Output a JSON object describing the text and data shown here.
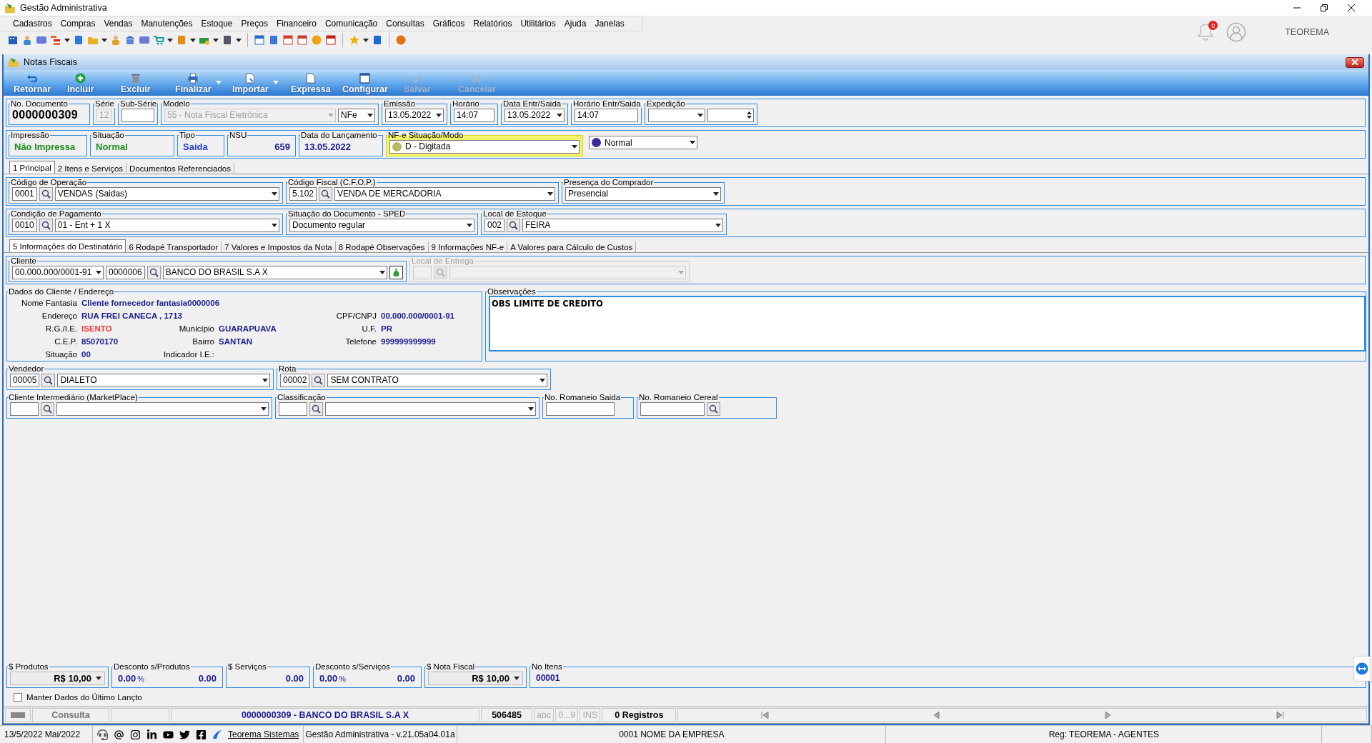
{
  "window": {
    "title": "Gestão Administrativa"
  },
  "menu": [
    "Cadastros",
    "Compras",
    "Vendas",
    "Manutenções",
    "Estoque",
    "Preços",
    "Financeiro",
    "Comunicação",
    "Consultas",
    "Gráficos",
    "Relatórios",
    "Utilitários",
    "Ajuda",
    "Janelas"
  ],
  "header_right": {
    "notifications": "0",
    "user": "TEOREMA"
  },
  "document_window": {
    "title": "Notas Fiscais"
  },
  "actions": [
    {
      "label": "Retornar",
      "disabled": false,
      "dropdown": false
    },
    {
      "label": "Incluir",
      "disabled": false,
      "dropdown": false
    },
    {
      "label": "Excluir",
      "disabled": false,
      "dropdown": false
    },
    {
      "label": "Finalizar",
      "disabled": false,
      "dropdown": true
    },
    {
      "label": "Importar",
      "disabled": false,
      "dropdown": true
    },
    {
      "label": "Expressa",
      "disabled": false,
      "dropdown": false
    },
    {
      "label": "Configurar",
      "disabled": false,
      "dropdown": false
    },
    {
      "label": "Salvar",
      "disabled": true,
      "dropdown": false
    },
    {
      "label": "Cancelar",
      "disabled": true,
      "dropdown": false
    }
  ],
  "header_row_1": [
    {
      "kind": "number",
      "label": "No. Documento",
      "value": "0000000309"
    },
    {
      "kind": "field",
      "label": "Série",
      "value": "12",
      "disabled": true
    },
    {
      "kind": "field",
      "label": "Sub-Série",
      "disabled": false
    },
    {
      "kind": "model",
      "label": "Modelo",
      "value": "55 - Nota Fiscal Eletrônica",
      "type": "NFe",
      "disabled": true
    },
    {
      "kind": "date",
      "label": "Emissão",
      "value": "13.05.2022"
    },
    {
      "kind": "field",
      "label": "Horário",
      "value": "14:07",
      "disabled": false
    },
    {
      "kind": "date",
      "label": "Data Entr/Saida",
      "value": "13.05.2022"
    },
    {
      "kind": "field",
      "label": "Horário Entr/Saida",
      "value": "14:07",
      "disabled": false
    },
    {
      "kind": "expedition",
      "label": "Expedição"
    }
  ],
  "header_row_2": [
    {
      "kind": "status",
      "label": "Impressão",
      "value": "Não Impressa",
      "color": "#1a8c1a"
    },
    {
      "kind": "status",
      "label": "Situação",
      "value": "Normal",
      "color": "#1a8c1a"
    },
    {
      "kind": "status",
      "label": "Tipo",
      "value": "Saida",
      "color": "#1f3fd8"
    },
    {
      "kind": "count",
      "label": "NSU",
      "value": "659",
      "color": "#1b1b8f"
    },
    {
      "kind": "status",
      "label": "Data do Lançamento",
      "value": "13.05.2022",
      "color": "#1b1b8f"
    },
    {
      "kind": "mode",
      "label": "NF-e Situação/Modo",
      "value": "D - Digitada",
      "color": "#b8b860",
      "highlighted": true
    },
    {
      "kind": "combo",
      "value": "Normal",
      "color": "#3b2c9e"
    }
  ],
  "tabs": [
    {
      "label": "1 Principal",
      "selected": true
    },
    {
      "label": "2 Itens e Serviços",
      "selected": false
    },
    {
      "label": "Documentos Referenciados",
      "selected": false
    }
  ],
  "operation_row": [
    {
      "kind": "lookup",
      "label": "Código de Operação",
      "code": "0001",
      "value": "VENDAS (Saidas)"
    },
    {
      "kind": "lookup",
      "label": "Código Fiscal (C.F.O.P.)",
      "code": "5.102",
      "value": "VENDA DE MERCADORIA"
    },
    {
      "kind": "combo",
      "label": "Presença do Comprador",
      "value": "Presencial"
    }
  ],
  "payment_row": [
    {
      "kind": "lookup",
      "label": "Condição de Pagamento",
      "code": "0010",
      "value": "01 - Ent + 1 X"
    },
    {
      "kind": "combo",
      "label": "Situação do Documento - SPED",
      "value": "Documento regular"
    },
    {
      "kind": "lookup",
      "label": "Local de Estoque",
      "code": "002",
      "value": "FEIRA"
    }
  ],
  "sub_tabs": [
    {
      "label": "5 Informações do Destinatário",
      "selected": true
    },
    {
      "label": "6 Rodapé Transportador",
      "selected": false
    },
    {
      "label": "7 Valores e Impostos da Nota",
      "selected": false
    },
    {
      "label": "8 Rodapé Observações",
      "selected": false
    },
    {
      "label": "9 Informações NF-e",
      "selected": false
    },
    {
      "label": "A Valores para Cálculo de Custos",
      "selected": false
    }
  ],
  "client": {
    "label": "Cliente",
    "cnpj": "00.000.000/0001-91",
    "code": "0000006",
    "name": "BANCO DO BRASIL S.A X"
  },
  "delivery": {
    "label": "Local de Entrega",
    "disabled": true
  },
  "client_data": {
    "label": "Dados do Cliente / Endereço",
    "rows": [
      {
        "left": {
          "label": "Nome Fantasia",
          "value": "Cliente fornecedor fantasia0000006"
        }
      },
      {
        "left": {
          "label": "Endereço",
          "value": "RUA FREI CANECA , 1713"
        },
        "right": {
          "label": "CPF/CNPJ",
          "value": "00.000.000/0001-91"
        }
      },
      {
        "left": {
          "label": "R.G./I.E.",
          "value": "ISENTO",
          "color": "#f03c3c"
        },
        "middle": {
          "label": "Município",
          "value": "GUARAPUAVA"
        },
        "right": {
          "label": "U.F.",
          "value": "PR"
        }
      },
      {
        "left": {
          "label": "C.E.P.",
          "value": "85070170"
        },
        "middle": {
          "label": "Bairro",
          "value": "SANTAN"
        },
        "right": {
          "label": "Telefone",
          "value": "999999999999"
        }
      },
      {
        "left": {
          "label": "Situação",
          "value": "00"
        },
        "middle": {
          "label": "Indicador I.E.:"
        }
      }
    ]
  },
  "notes": {
    "label": "Observações",
    "value": "OBS LIMITE DE CREDITO"
  },
  "seller_row": [
    {
      "kind": "lookup",
      "label": "Vendedor",
      "code": "00005",
      "value": "DIALETO"
    },
    {
      "kind": "lookup",
      "label": "Rota",
      "code": "00002",
      "value": "SEM CONTRATO"
    }
  ],
  "extra_row": [
    {
      "kind": "lookup",
      "label": "Cliente Intermediário (MarketPlace)"
    },
    {
      "kind": "lookup",
      "label": "Classificação"
    },
    {
      "kind": "field",
      "label": "No. Romaneio Saida"
    },
    {
      "kind": "search",
      "label": "No. Romaneio Cereal"
    }
  ],
  "totals": [
    {
      "kind": "currency",
      "label": "$ Produtos",
      "value": "R$ 10,00"
    },
    {
      "kind": "discount",
      "label": "Desconto s/Produtos",
      "percent": "0.00",
      "sign": "%",
      "value": "0.00"
    },
    {
      "kind": "amount",
      "label": "$ Serviços",
      "value": "0.00"
    },
    {
      "kind": "discount",
      "label": "Desconto s/Serviços",
      "percent": "0.00",
      "sign": "%",
      "value": "0.00"
    },
    {
      "kind": "currency",
      "label": "$ Nota Fiscal",
      "value": "R$ 10,00"
    },
    {
      "kind": "count",
      "label": "No Itens",
      "value": "00001"
    }
  ],
  "keep_last": {
    "label": "Manter Dados do Último Lançto",
    "checked": false
  },
  "status_bar": {
    "mode": "Consulta",
    "record": "0000000309 - BANCO DO BRASIL S.A X",
    "code": "506485",
    "indicators": [
      "abc",
      "0...9",
      "INS"
    ],
    "count": "0 Registros"
  },
  "footer": {
    "date": "13/5/2022 Mai/2022",
    "link": "Teorema Sistemas",
    "version": "Gestão Administrativa - v.21.05a04.01a",
    "company": "0001 NOME DA EMPRESA",
    "registration": "Reg: TEOREMA - AGENTES"
  }
}
